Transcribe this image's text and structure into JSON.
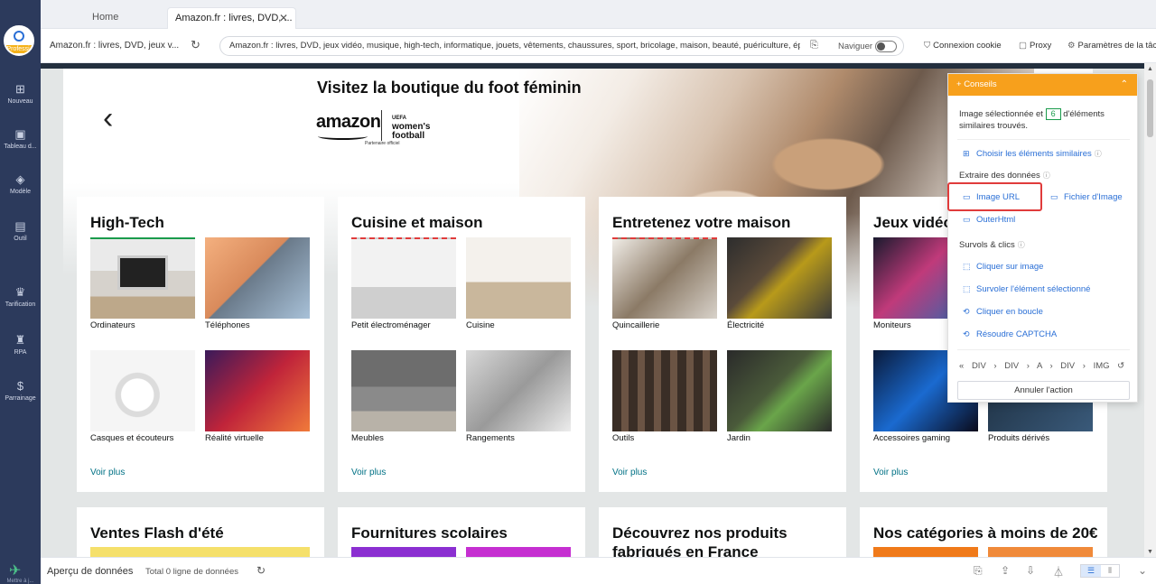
{
  "sidebar": {
    "badge": "Professi...",
    "items": [
      {
        "icon": "plus-square-icon",
        "label": "Nouveau"
      },
      {
        "icon": "dashboard-icon",
        "label": "Tableau d..."
      },
      {
        "icon": "template-icon",
        "label": "Modèle"
      },
      {
        "icon": "toolbox-icon",
        "label": "Outil"
      },
      {
        "icon": "crown-icon",
        "label": "Tarification"
      },
      {
        "icon": "robot-icon",
        "label": "RPA"
      },
      {
        "icon": "dollar-coin-icon",
        "label": "Parrainage"
      }
    ],
    "footer_label": "Mettre à j..."
  },
  "tabs": [
    {
      "label": "Home"
    },
    {
      "label": "Amazon.fr : livres, DVD, ...",
      "active": true
    }
  ],
  "addressbar": {
    "page_title": "Amazon.fr : livres, DVD, jeux v...",
    "url": "Amazon.fr : livres, DVD, jeux vidéo, musique, high-tech, informatique, jouets, vêtements, chaussures, sport, bricolage, maison, beauté, puériculture, épice...",
    "navigate_label": "Naviguer",
    "cookie_label": "Connexion cookie",
    "proxy_label": "Proxy",
    "params_label": "Paramètres de la tâche"
  },
  "hero": {
    "title": "Visitez la boutique du foot féminin",
    "brand": "amazon",
    "partner": "Partenaire officiel",
    "wf_line1": "UEFA",
    "wf_line2": "women's",
    "wf_line3": "football"
  },
  "cards": [
    {
      "title": "High-Tech",
      "tiles": [
        "Ordinateurs",
        "Téléphones",
        "Casques et écouteurs",
        "Réalité virtuelle"
      ],
      "more": "Voir plus"
    },
    {
      "title": "Cuisine et maison",
      "tiles": [
        "Petit électroménager",
        "Cuisine",
        "Meubles",
        "Rangements"
      ],
      "more": "Voir plus"
    },
    {
      "title": "Entretenez votre maison",
      "tiles": [
        "Quincaillerie",
        "Électricité",
        "Outils",
        "Jardin"
      ],
      "more": "Voir plus"
    },
    {
      "title": "Jeux vidéo",
      "tiles": [
        "Moniteurs",
        "",
        "Accessoires gaming",
        "Produits dérivés"
      ],
      "more": "Voir plus"
    }
  ],
  "cards_row2": [
    {
      "title": "Ventes Flash d'été",
      "color": "#f5e06b"
    },
    {
      "title": "Fournitures scolaires",
      "color": "#8b2fd1"
    },
    {
      "title": "Découvrez nos produits fabriqués en France",
      "color": "#ffffff"
    },
    {
      "title": "Nos catégories à moins de 20€",
      "color": "#f07a1a"
    }
  ],
  "tips": {
    "header": "Conseils",
    "intro_before": "Image sélectionnée et",
    "count": "6",
    "intro_after": "d'éléments",
    "intro_line2": "similaires trouvés.",
    "choose_similar": "Choisir les éléments similaires",
    "extract_section": "Extraire des données",
    "image_url": "Image URL",
    "image_file": "Fichier d'Image",
    "outer_html": "OuterHtml",
    "hover_section": "Survols & clics",
    "click_image": "Cliquer sur image",
    "hover_selected": "Survoler l'élément sélectionné",
    "click_loop": "Cliquer en boucle",
    "solve_captcha": "Résoudre CAPTCHA",
    "breadcrumb": [
      "DIV",
      "DIV",
      "A",
      "DIV",
      "IMG"
    ],
    "cancel": "Annuler l'action"
  },
  "bottombar": {
    "title": "Aperçu de données",
    "count": "Total 0 ligne de données"
  },
  "colors": {
    "sidebar": "#2c3a5c",
    "accent": "#f7a01c",
    "link": "#2a6fd6",
    "highlight": "#e03b3b",
    "selected": "#1a9b4b"
  }
}
